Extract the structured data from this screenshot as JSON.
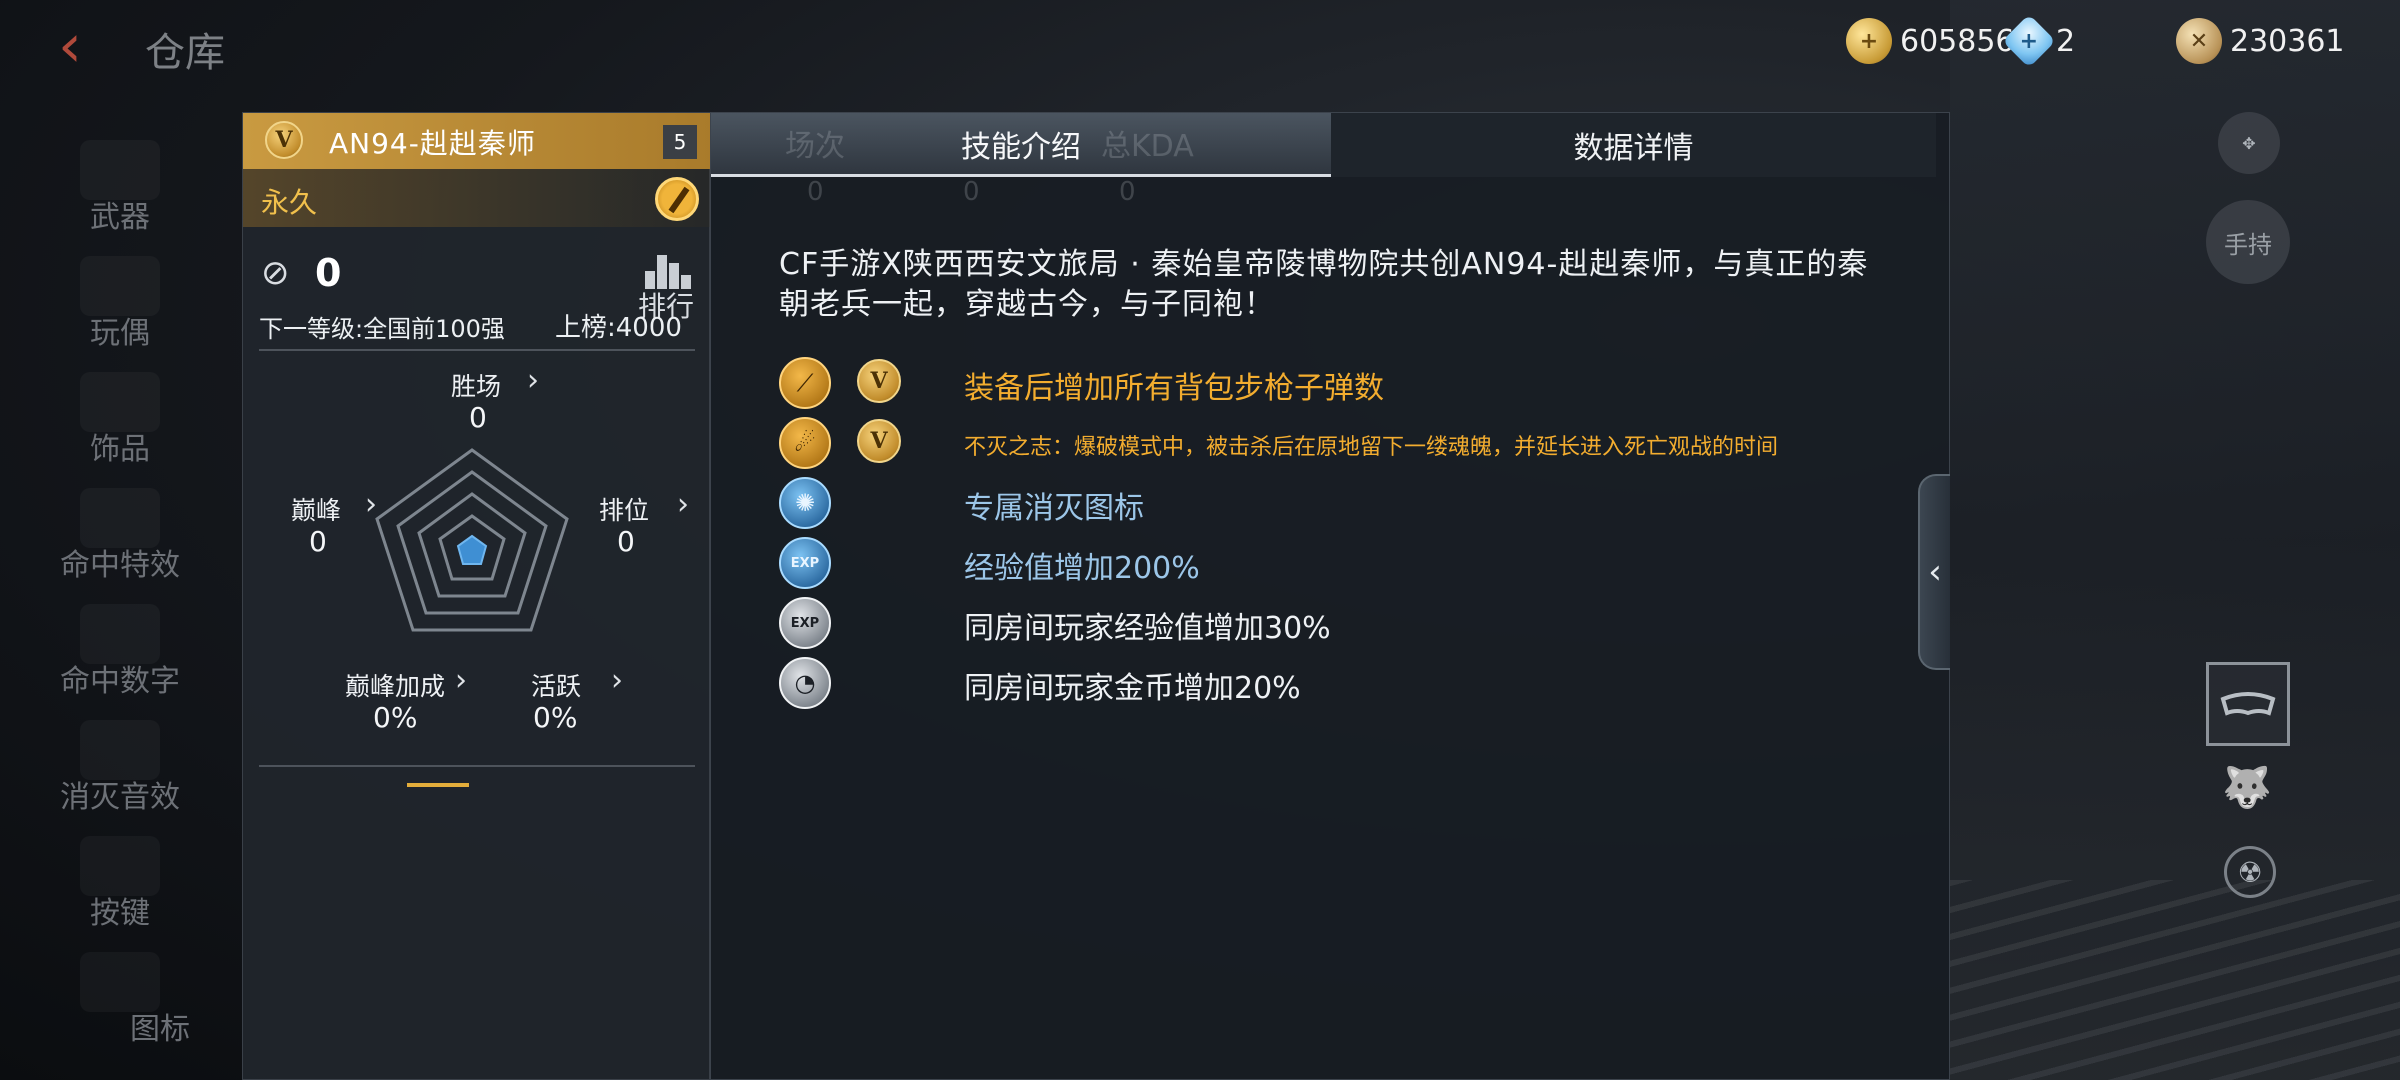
{
  "header": {
    "back_icon": "chevron-left-icon",
    "title": "仓库",
    "currencies": [
      {
        "icon": "gold-coin-plus-icon",
        "value": "605856"
      },
      {
        "icon": "diamond-plus-icon",
        "value": "2"
      },
      {
        "icon": "crossed-swords-coin-icon",
        "value": "230361"
      }
    ]
  },
  "sidebar": {
    "items": [
      {
        "label": "武器"
      },
      {
        "label": "玩偶"
      },
      {
        "label": "饰品"
      },
      {
        "label": "命中特效"
      },
      {
        "label": "命中数字"
      },
      {
        "label": "消灭音效"
      },
      {
        "label": "按键"
      },
      {
        "label": "图标"
      }
    ]
  },
  "weapon_card": {
    "name": "AN94-赳赳秦师",
    "level": "5",
    "duration": "永久",
    "rank_value": "0",
    "leaderboard_label": "排行",
    "next_level": "下一等级:全国前100强",
    "board_threshold": "上榜:4000",
    "stats": {
      "wins": {
        "label": "胜场",
        "value": "0"
      },
      "peak": {
        "label": "巅峰",
        "value": "0"
      },
      "ranked": {
        "label": "排位",
        "value": "0"
      },
      "peak_bonus": {
        "label": "巅峰加成",
        "value": "0%"
      },
      "active": {
        "label": "活跃",
        "value": "0%"
      }
    }
  },
  "details": {
    "tabs": [
      {
        "label": "技能介绍",
        "active": true
      },
      {
        "label": "数据详情",
        "active": false
      }
    ],
    "ghost_tabs": [
      "场次",
      "总KDA"
    ],
    "ghost_zeros": [
      "0",
      "0",
      "0"
    ],
    "description": "CF手游X陕西西安文旅局 · 秦始皇帝陵博物院共创AN94-赳赳秦师，与真正的秦朝老兵一起，穿越古今，与子同袍！",
    "skills": [
      {
        "icon": "rifle-ammo-icon",
        "v_badge": true,
        "text": "装备后增加所有背包步枪子弹数",
        "color": "gold"
      },
      {
        "icon": "soul-figure-icon",
        "v_badge": true,
        "text": "不灭之志：爆破模式中，被击杀后在原地留下一缕魂魄，并延长进入死亡观战的时间",
        "color": "gold"
      },
      {
        "icon": "kill-emblem-icon",
        "v_badge": false,
        "text": "专属消灭图标",
        "color": "blue"
      },
      {
        "icon": "exp-boost-icon",
        "v_badge": false,
        "text": "经验值增加200%",
        "color": "blue"
      },
      {
        "icon": "room-exp-icon",
        "v_badge": false,
        "text": "同房间玩家经验值增加30%",
        "color": "white"
      },
      {
        "icon": "room-gold-icon",
        "v_badge": false,
        "text": "同房间玩家金币增加20%",
        "color": "white"
      }
    ],
    "exp_icon_text": "EXP"
  },
  "side_controls": {
    "hand_label": "手持"
  }
}
